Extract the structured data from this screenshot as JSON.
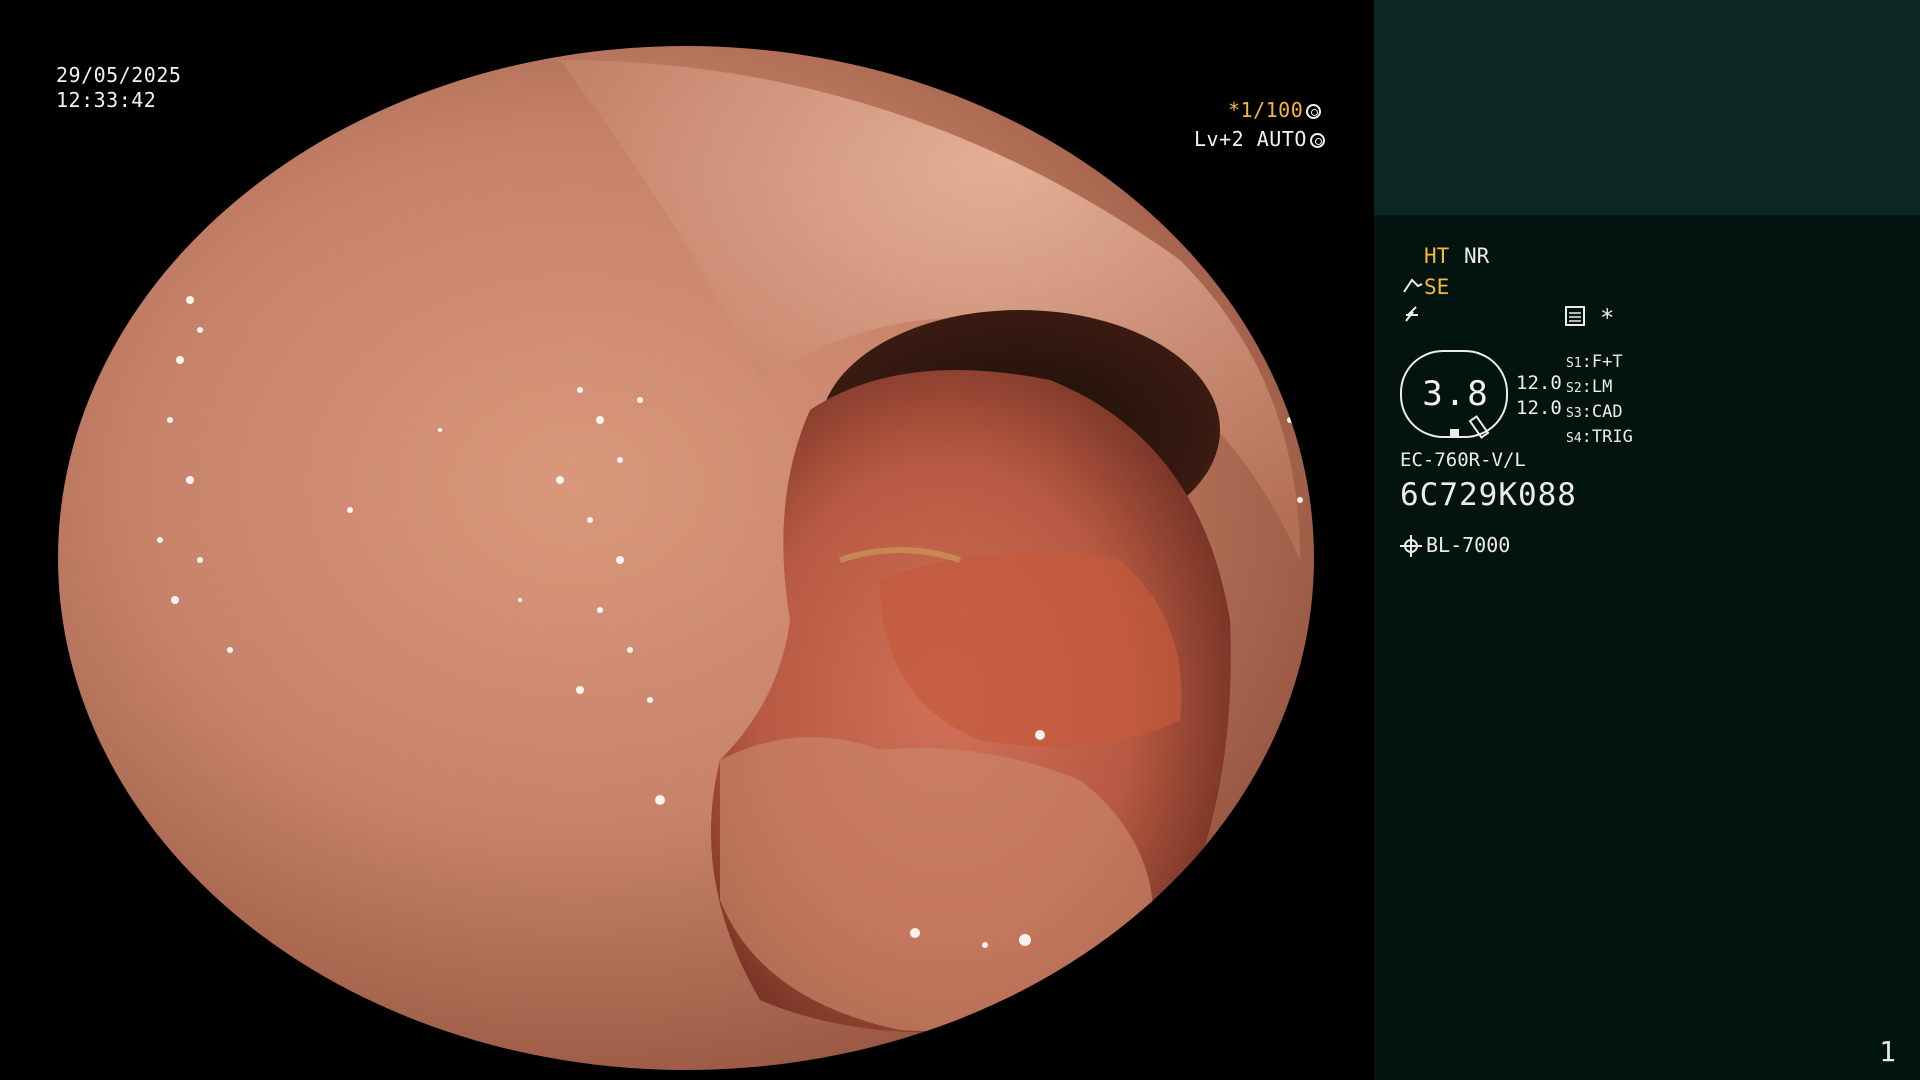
{
  "overlay": {
    "date": "29/05/2025",
    "time": "12:33:42",
    "shutter": "*1/100",
    "iris": "Lv+2 AUTO"
  },
  "panel": {
    "ht": "HT",
    "nr": "NR",
    "se": "SE",
    "se_icon": "brush-icon",
    "freeze_icon": "lightning-icon",
    "image_mode_icon": "image-mode-icon",
    "asterisk": "*",
    "scale": "3.8",
    "value_1": "12.0",
    "value_2": "12.0",
    "switches": [
      {
        "key": "S1",
        "value": "F+T"
      },
      {
        "key": "S2",
        "value": "LM"
      },
      {
        "key": "S3",
        "value": "CAD"
      },
      {
        "key": "S4",
        "value": "TRIG"
      }
    ],
    "scope_model": "EC-760R-V/L",
    "scope_serial": "6C729K088",
    "light_source": "BL-7000",
    "page": "1"
  },
  "colors": {
    "panel_bg": "#031310",
    "panel_top": "#0b2723",
    "accent_yellow": "#f3b73a",
    "text": "#ececec"
  }
}
